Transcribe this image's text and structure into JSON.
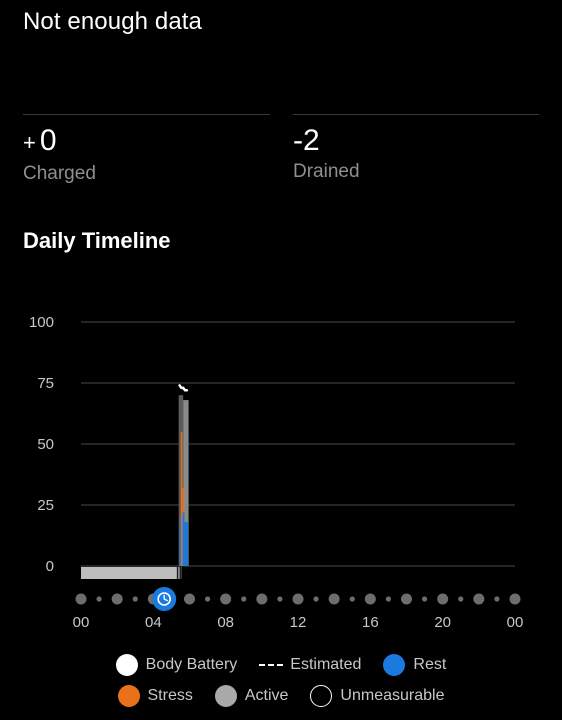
{
  "status": {
    "title": "Not enough data"
  },
  "stats": {
    "charged": {
      "prefix": "+",
      "value": "0",
      "label": "Charged"
    },
    "drained": {
      "value": "-2",
      "label": "Drained"
    }
  },
  "timeline": {
    "title": "Daily Timeline"
  },
  "legend": {
    "items": [
      {
        "label": "Body Battery",
        "icon": "body-battery-icon",
        "color": "#ffffff",
        "style": "filled"
      },
      {
        "label": "Estimated",
        "icon": "estimated-line-icon",
        "color": "#ffffff",
        "style": "dashed"
      },
      {
        "label": "Rest",
        "icon": "rest-icon",
        "color": "#1a7ae0",
        "style": "filled"
      },
      {
        "label": "Stress",
        "icon": "stress-icon",
        "color": "#e8711c",
        "style": "filled"
      },
      {
        "label": "Active",
        "icon": "active-icon",
        "color": "#a9a9a9",
        "style": "filled"
      },
      {
        "label": "Unmeasurable",
        "icon": "unmeasurable-icon",
        "color": "#ffffff",
        "style": "hollow"
      }
    ]
  },
  "colors": {
    "rest": "#1a7ae0",
    "stress": "#e8711c",
    "active": "#a9a9a9",
    "body_battery": "#ffffff",
    "gridline": "#4a4a4a",
    "dot": "#6d6d6d"
  },
  "chart_data": {
    "type": "bar",
    "title": "",
    "xlabel": "",
    "ylabel": "",
    "xlim": [
      0,
      24
    ],
    "ylim": [
      0,
      100
    ],
    "y_ticks": [
      0,
      25,
      50,
      75,
      100
    ],
    "x_tick_labels": [
      "00",
      "04",
      "08",
      "12",
      "16",
      "20",
      "00"
    ],
    "x_tick_hours": [
      0,
      4,
      8,
      12,
      16,
      20,
      24
    ],
    "grid": true,
    "legend_position": "bottom",
    "current_time_marker": {
      "hour": 4.6,
      "icon": "clock-icon"
    },
    "unmeasurable_band": {
      "start_hour": 0,
      "end_hour": 5.55
    },
    "series": [
      {
        "name": "Active",
        "segments": [
          {
            "start_hour": 5.4,
            "end_hour": 5.65,
            "top": 70
          },
          {
            "start_hour": 5.65,
            "end_hour": 5.95,
            "top": 68
          }
        ]
      },
      {
        "name": "Stress",
        "segments": [
          {
            "start_hour": 5.52,
            "end_hour": 5.58,
            "top": 55
          },
          {
            "start_hour": 5.6,
            "end_hour": 5.64,
            "top": 32
          }
        ]
      },
      {
        "name": "Rest",
        "segments": [
          {
            "start_hour": 5.45,
            "end_hour": 5.52,
            "top": 20
          },
          {
            "start_hour": 5.62,
            "end_hour": 5.72,
            "top": 22
          },
          {
            "start_hour": 5.72,
            "end_hour": 5.92,
            "top": 18
          }
        ]
      },
      {
        "name": "Body Battery",
        "points": [
          {
            "hour": 5.45,
            "value": 74
          },
          {
            "hour": 5.55,
            "value": 73
          },
          {
            "hour": 5.65,
            "value": 73
          },
          {
            "hour": 5.75,
            "value": 72
          },
          {
            "hour": 5.85,
            "value": 72
          }
        ]
      }
    ]
  }
}
